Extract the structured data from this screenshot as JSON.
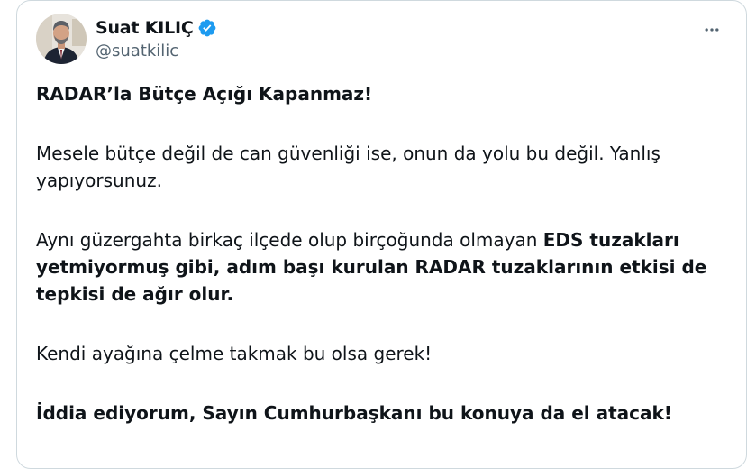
{
  "author": {
    "display_name": "Suat KILIÇ",
    "handle": "@suatkilic",
    "verified": true,
    "verified_color": "#1d9bf0"
  },
  "menu_icon": "more-horizontal-icon",
  "tweet": {
    "title": "RADAR’la Bütçe Açığı Kapanmaz!",
    "p1": "Mesele bütçe değil de can güvenliği ise, onun da yolu bu değil. Yanlış yapıyorsunuz.",
    "p2_normal": "Aynı güzergahta birkaç ilçede olup birçoğunda olmayan ",
    "p2_bold": "EDS tuzakları yetmiyormuş gibi, adım başı kurulan RADAR tuzaklarının etkisi de tepkisi de ağır olur.",
    "p3": "Kendi ayağına çelme takmak bu olsa gerek!",
    "p4": "İddia ediyorum, Sayın Cumhurbaşkanı bu konuya da el atacak!"
  },
  "colors": {
    "text": "#0f1419",
    "secondary": "#536471",
    "border": "#cfd9de"
  }
}
